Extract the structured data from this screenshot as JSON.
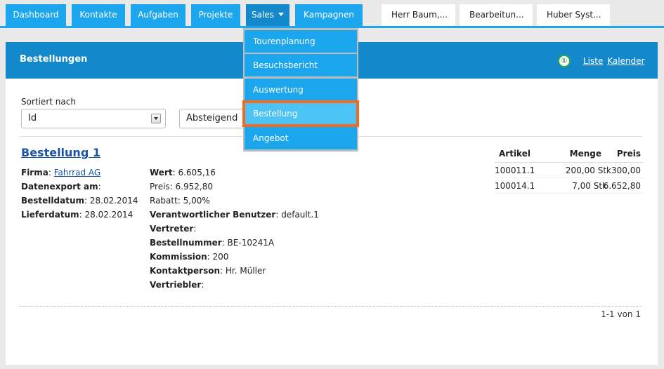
{
  "nav": {
    "tabs": [
      "Dashboard",
      "Kontakte",
      "Aufgaben",
      "Projekte",
      "Sales",
      "Kampagnen"
    ],
    "open_tabs": [
      "Herr Baum,...",
      "Bearbeitun...",
      "Huber Syst..."
    ]
  },
  "sales_menu": [
    "Tourenplanung",
    "Besuchsbericht",
    "Auswertung",
    "Bestellung",
    "Angebot"
  ],
  "panel": {
    "title": "Bestellungen",
    "view_liste": "Liste",
    "view_kalender": "Kalender",
    "info_glyph": "①"
  },
  "sort": {
    "label": "Sortiert nach",
    "field_value": "Id",
    "order_value": "Absteigend"
  },
  "order": {
    "title": "Bestellung 1",
    "left": [
      {
        "label": "Firma",
        "value": "Fahrrad AG"
      },
      {
        "label": "Datenexport am",
        "value": ""
      },
      {
        "label": "Bestelldatum",
        "value": "28.02.2014"
      },
      {
        "label": "Lieferdatum",
        "value": "28.02.2014"
      }
    ],
    "right": [
      {
        "label": "Wert",
        "value": "6.605,16"
      },
      {
        "label": "Preis",
        "value": "6.952,80"
      },
      {
        "label": "Rabatt",
        "value": "5,00%"
      },
      {
        "label": "Verantwortlicher Benutzer",
        "value": "default.1"
      },
      {
        "label": "Vertreter",
        "value": ""
      },
      {
        "label": "Bestellnummer",
        "value": "BE-10241A"
      },
      {
        "label": "Kommission",
        "value": "200"
      },
      {
        "label": "Kontaktperson",
        "value": "Hr. Müller"
      },
      {
        "label": "Vertriebler",
        "value": ""
      }
    ]
  },
  "articles": {
    "headers": [
      "Artikel",
      "Menge",
      "Preis"
    ],
    "rows": [
      [
        "100011.1",
        "200,00 Stk",
        "300,00"
      ],
      [
        "100014.1",
        "7,00 Stk",
        "6.652,80"
      ]
    ]
  },
  "pager": "1-1 von 1",
  "colors": {
    "nav_blue": "#1ba6ee",
    "header_blue": "#1389cc",
    "highlight_orange": "#f26b21"
  }
}
